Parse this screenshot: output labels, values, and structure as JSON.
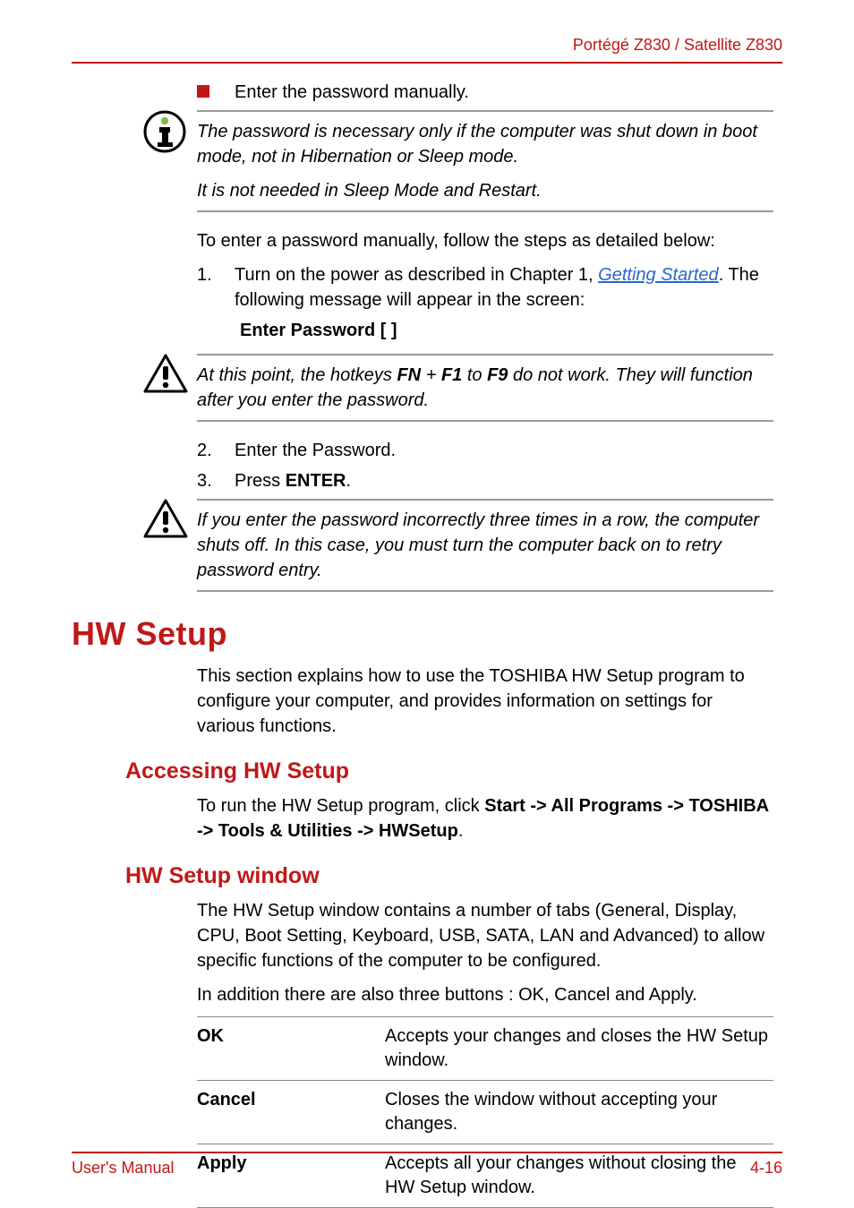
{
  "header": {
    "product": "Portégé Z830 / Satellite Z830"
  },
  "intro_bullet": "Enter the password manually.",
  "callout1": {
    "p1": "The password is necessary only if the computer was shut down in boot mode, not in Hibernation or Sleep mode.",
    "p2": "It is not needed in Sleep Mode and Restart."
  },
  "body1": "To enter a password manually, follow the steps as detailed below:",
  "steps_a": {
    "n1": "1.",
    "t1a": "Turn on the power as described in Chapter 1, ",
    "t1link": "Getting Started",
    "t1b": ". The following message will appear in the screen:",
    "sub": "Enter Password [ ]"
  },
  "callout2": {
    "prefix": "At this point, the hotkeys ",
    "fn": "FN",
    "plus": " + ",
    "f1": "F1",
    "mid": " to ",
    "f9": "F9",
    "suffix": " do not work. They will function after you enter the password."
  },
  "steps_b": {
    "n2": "2.",
    "t2": "Enter the Password.",
    "n3": "3.",
    "t3a": "Press ",
    "t3b": "ENTER",
    "t3c": "."
  },
  "callout3": {
    "text": "If you enter the password incorrectly three times in a row, the computer shuts off. In this case, you must turn the computer back on to retry password entry."
  },
  "hw_setup": {
    "title": "HW Setup",
    "intro": "This section explains how to use the TOSHIBA HW Setup program to configure your computer, and provides information on settings for various functions.",
    "accessing_title": "Accessing HW Setup",
    "accessing_p_a": "To run the HW Setup program, click ",
    "accessing_p_b": "Start -> All Programs -> TOSHIBA -> Tools & Utilities -> HWSetup",
    "accessing_p_c": ".",
    "window_title": "HW Setup window",
    "window_p1": "The HW Setup window contains a number of tabs (General, Display, CPU, Boot Setting, Keyboard, USB, SATA, LAN and Advanced) to allow specific functions of the computer to be configured.",
    "window_p2": "In addition there are also three buttons : OK, Cancel and Apply.",
    "rows": [
      {
        "key": "OK",
        "val": "Accepts your changes and closes the HW Setup window."
      },
      {
        "key": "Cancel",
        "val": "Closes the window without accepting your changes."
      },
      {
        "key": "Apply",
        "val": "Accepts all your changes without closing the HW Setup window."
      }
    ]
  },
  "footer": {
    "left": "User's Manual",
    "right": "4-16"
  }
}
